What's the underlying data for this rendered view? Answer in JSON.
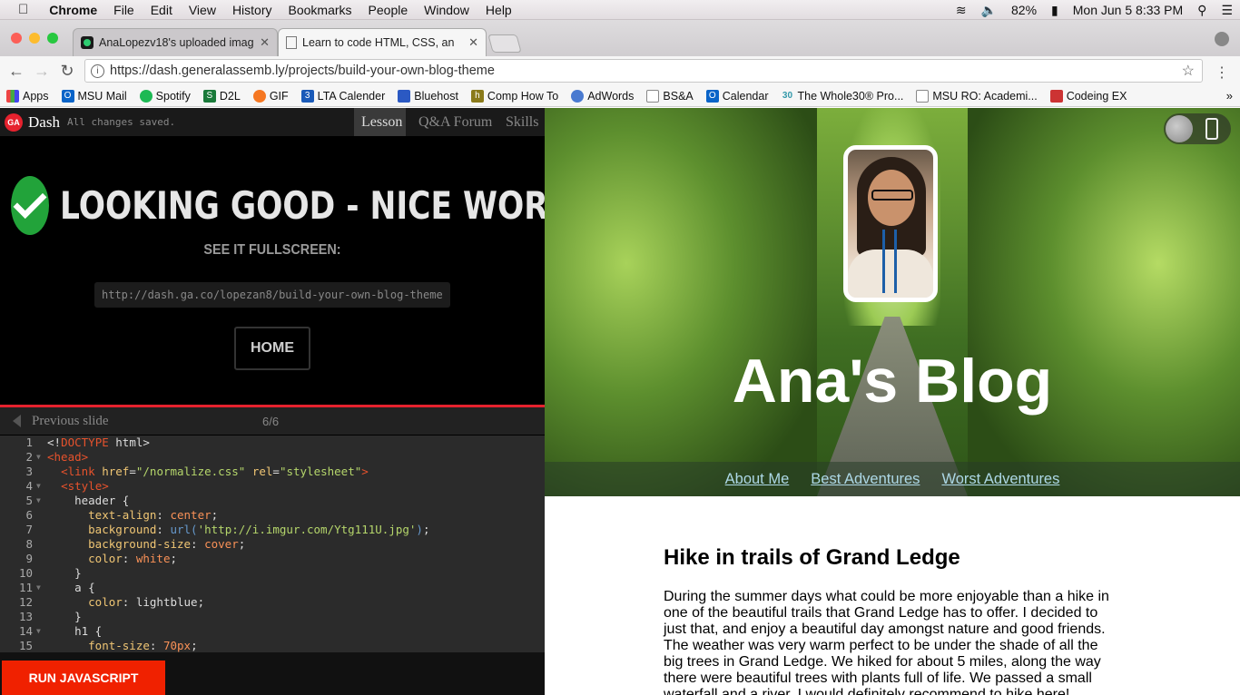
{
  "menubar": {
    "apple": "",
    "app": "Chrome",
    "items": [
      "File",
      "Edit",
      "View",
      "History",
      "Bookmarks",
      "People",
      "Window",
      "Help"
    ],
    "battery": "82%",
    "datetime": "Mon Jun 5  8:33 PM"
  },
  "tabs": [
    {
      "title": "AnaLopezv18's uploaded imag"
    },
    {
      "title": "Learn to code HTML, CSS, an"
    }
  ],
  "address": {
    "url": "https://dash.generalassemb.ly/projects/build-your-own-blog-theme"
  },
  "bookmarks": [
    "Apps",
    "MSU Mail",
    "Spotify",
    "D2L",
    "GIF",
    "LTA Calender",
    "Bluehost",
    "Comp How To",
    "AdWords",
    "BS&A",
    "Calendar",
    "The Whole30® Pro...",
    "MSU RO: Academi...",
    "Codeing EX"
  ],
  "dash": {
    "logo": "GA",
    "title": "Dash",
    "saved": "All changes saved.",
    "tabs": [
      "Lesson",
      "Q&A Forum",
      "Skills"
    ],
    "message": "LOOKING GOOD - NICE WORK!",
    "see_fullscreen": "SEE IT FULLSCREEN:",
    "share_url": "http://dash.ga.co/lopezan8/build-your-own-blog-theme",
    "home": "HOME",
    "prev_slide": "Previous slide",
    "slide_count": "6/6",
    "run": "RUN JAVASCRIPT"
  },
  "code_lines": [
    {
      "n": "1",
      "h": "<span class='ct'>&lt;!<span class='tg'>DOCTYPE</span> html&gt;</span>"
    },
    {
      "n": "2",
      "h": "<span class='ct'><span class='tg'>&lt;head&gt;</span></span>"
    },
    {
      "n": "3",
      "h": "<span class='ct'>  <span class='tg'>&lt;link</span> <span class='at'>href</span>=<span class='st'>\"/normalize.css\"</span> <span class='at'>rel</span>=<span class='st'>\"stylesheet\"</span><span class='tg'>&gt;</span></span>"
    },
    {
      "n": "4",
      "h": "<span class='ct'>  <span class='tg'>&lt;style&gt;</span></span>"
    },
    {
      "n": "5",
      "h": "<span class='ct'>    header {</span>"
    },
    {
      "n": "6",
      "h": "<span class='ct'>      <span class='pr'>text-align</span>: <span class='vl'>center</span>;</span>"
    },
    {
      "n": "7",
      "h": "<span class='ct'>      <span class='pr'>background</span>: <span class='fn'>url(</span><span class='st'>'http://i.imgur.com/Ytg111U.jpg'</span><span class='fn'>)</span>;</span>"
    },
    {
      "n": "8",
      "h": "<span class='ct'>      <span class='pr'>background-size</span>: <span class='vl'>cover</span>;</span>"
    },
    {
      "n": "9",
      "h": "<span class='ct'>      <span class='pr'>color</span>: <span class='vl'>white</span>;</span>"
    },
    {
      "n": "10",
      "h": "<span class='ct'>    }</span>"
    },
    {
      "n": "11",
      "h": "<span class='ct'>    a {</span>"
    },
    {
      "n": "12",
      "h": "<span class='ct'>      <span class='pr'>color</span>: lightblue;</span>"
    },
    {
      "n": "13",
      "h": "<span class='ct'>    }</span>"
    },
    {
      "n": "14",
      "h": "<span class='ct'>    h1 {</span>"
    },
    {
      "n": "15",
      "h": "<span class='ct'>      <span class='pr'>font-size</span>: <span class='vl'>70px</span>;</span>"
    }
  ],
  "blog": {
    "title": "Ana's Blog",
    "nav": [
      "About Me",
      "Best Adventures",
      "Worst Adventures"
    ],
    "post_title": "Hike in trails of Grand Ledge",
    "post_body": "During the summer days what could be more enjoyable than a hike in one of the beautiful trails that Grand Ledge has to offer. I decided to just that, and enjoy a beautiful day amongst nature and good friends. The weather was very warm perfect to be under the shade of all the big trees in Grand Ledge. We hiked for about 5 miles, along the way there were beautiful trees with plants full of life. We passed a small waterfall and a river. I would definitely recommend to hike here!"
  }
}
